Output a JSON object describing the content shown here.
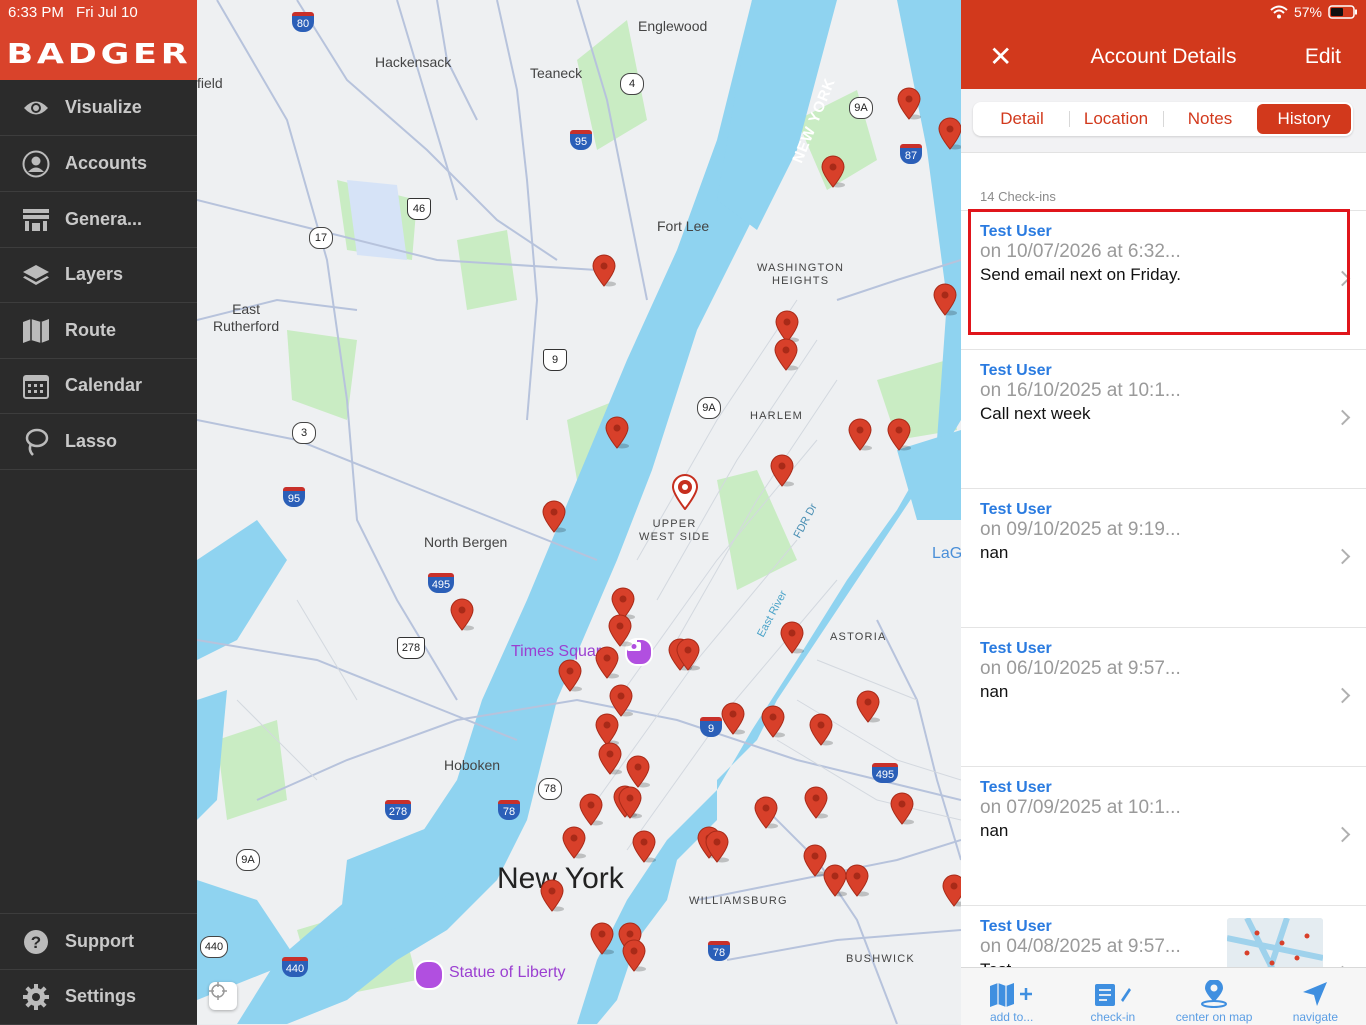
{
  "status_bar": {
    "time": "6:33 PM",
    "date": "Fri Jul 10",
    "wifi": "wifi-icon",
    "battery_percent": "57%"
  },
  "brand": {
    "name": "BADGER"
  },
  "sidebar": {
    "items": [
      {
        "label": "Visualize",
        "icon": "eye-icon"
      },
      {
        "label": "Accounts",
        "icon": "person-icon"
      },
      {
        "label": "Genera...",
        "icon": "storefront-icon"
      },
      {
        "label": "Layers",
        "icon": "layers-icon"
      },
      {
        "label": "Route",
        "icon": "map-icon"
      },
      {
        "label": "Calendar",
        "icon": "calendar-icon"
      },
      {
        "label": "Lasso",
        "icon": "lasso-icon"
      }
    ],
    "bottom_items": [
      {
        "label": "Support",
        "icon": "help-icon"
      },
      {
        "label": "Settings",
        "icon": "gear-icon"
      }
    ]
  },
  "map": {
    "labels": {
      "englewood": "Englewood",
      "hackensack": "Hackensack",
      "teaneck": "Teaneck",
      "field": "field",
      "fort_lee": "Fort Lee",
      "east_rutherford": "East\nRutherford",
      "washington_heights": "WASHINGTON\nHEIGHTS",
      "harlem": "HARLEM",
      "upper_west_side": "UPPER\nWEST SIDE",
      "north_bergen": "North Bergen",
      "times_square": "Times Square",
      "astoria": "ASTORIA",
      "hoboken": "Hoboken",
      "new_york": "New York",
      "williamsburg": "WILLIAMSBURG",
      "bushwick": "BUSHWICK",
      "statue_of_liberty": "Statue of Liberty",
      "new_york_river": "NEW YORK",
      "fdr": "FDR Dr",
      "east_river": "East River",
      "lag": "LaG"
    },
    "shields": [
      "80",
      "4",
      "9A",
      "95",
      "87",
      "46",
      "17",
      "9",
      "9A",
      "3",
      "95",
      "495",
      "9",
      "495",
      "278",
      "78",
      "78",
      "9A",
      "440",
      "440",
      "78",
      "278",
      "9"
    ]
  },
  "panel": {
    "title": "Account Details",
    "close_label": "✕",
    "edit_label": "Edit",
    "tabs": [
      {
        "label": "Detail",
        "active": false
      },
      {
        "label": "Location",
        "active": false
      },
      {
        "label": "Notes",
        "active": false
      },
      {
        "label": "History",
        "active": true
      }
    ],
    "checkins_count": "14 Check-ins",
    "entries": [
      {
        "user": "Test User",
        "date": "on 10/07/2026 at 6:32...",
        "note": "Send email next on Friday."
      },
      {
        "user": "Test User",
        "date": "on 16/10/2025 at 10:1...",
        "note": "Call next week"
      },
      {
        "user": "Test User",
        "date": "on 09/10/2025 at 9:19...",
        "note": "nan"
      },
      {
        "user": "Test User",
        "date": "on 06/10/2025 at 9:57...",
        "note": "nan"
      },
      {
        "user": "Test User",
        "date": "on 07/09/2025 at 10:1...",
        "note": "nan"
      },
      {
        "user": "Test User",
        "date": "on 04/08/2025 at 9:57...",
        "note": "Test"
      }
    ],
    "toolbar": [
      {
        "label": "add to...",
        "icon": "map-add-icon"
      },
      {
        "label": "check-in",
        "icon": "checkin-note-icon"
      },
      {
        "label": "center on map",
        "icon": "location-pin-icon"
      },
      {
        "label": "navigate",
        "icon": "navigate-arrow-icon"
      }
    ]
  },
  "colors": {
    "brand": "#d9432b",
    "header": "#d2391c",
    "sidebar": "#2b2b2b",
    "link": "#2a7be0",
    "water": "#8fd3f0",
    "park": "#c9ecc3",
    "highlight": "#e0151b",
    "pin": "#d8402a"
  }
}
